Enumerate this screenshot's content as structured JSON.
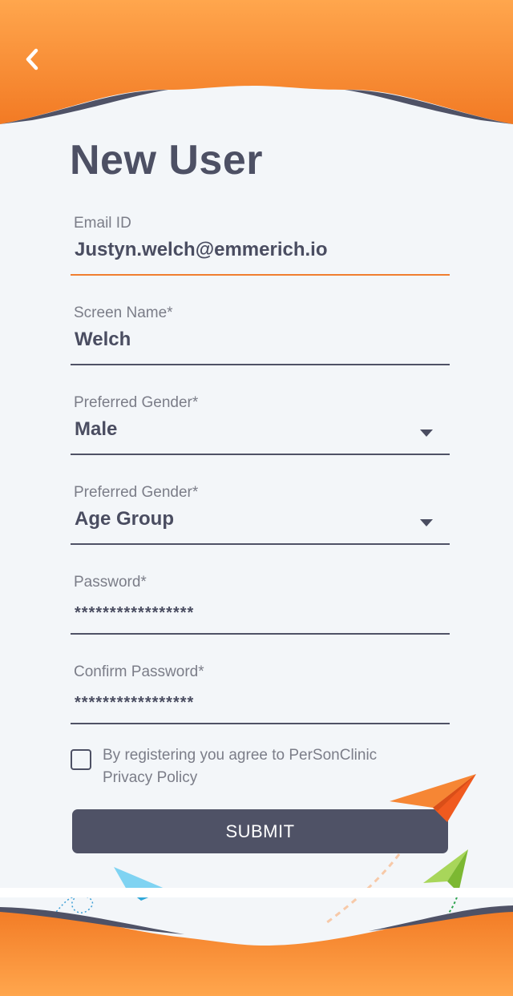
{
  "header": {
    "back_icon": "chevron-left-icon"
  },
  "title": "New User",
  "fields": {
    "email": {
      "label": "Email ID",
      "value": "Justyn.welch@emmerich.io",
      "active": true
    },
    "screen_name": {
      "label": "Screen Name*",
      "value": "Welch"
    },
    "gender": {
      "label": "Preferred Gender*",
      "value": "Male",
      "icon": "caret-down-icon"
    },
    "age_group": {
      "label": "Preferred Gender*",
      "value": "Age Group",
      "icon": "caret-down-icon"
    },
    "password": {
      "label": "Password*",
      "value": "*****************"
    },
    "confirm_password": {
      "label": "Confirm Password*",
      "value": "*****************"
    }
  },
  "agreement": {
    "checked": false,
    "line1": "By registering you agree to PerSonClinic",
    "line2": "Privacy Policy"
  },
  "submit_label": "SUBMIT",
  "colors": {
    "accent_orange": "#f07e2f",
    "dark": "#4f5266",
    "background": "#f3f6f9",
    "plane_blue": "#3bb8e8",
    "plane_green": "#8cc63f"
  }
}
